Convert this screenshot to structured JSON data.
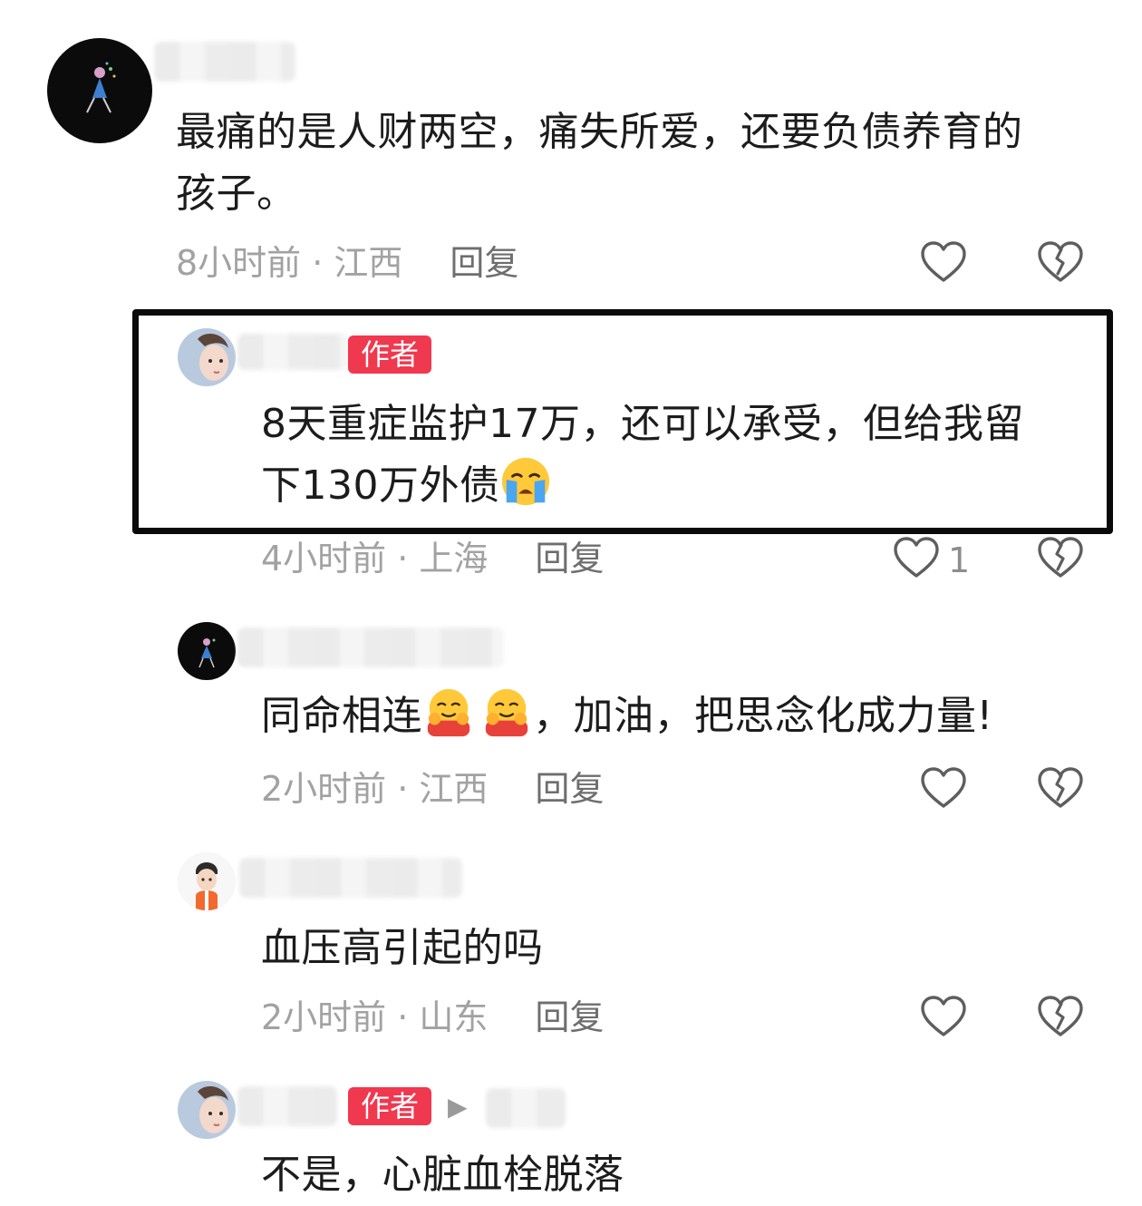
{
  "comments": [
    {
      "text_line1": "最痛的是人财两空，痛失所爱，还要负债养育的",
      "text_line2": "孩子。",
      "meta": "8小时前 · 江西",
      "reply_label": "回复"
    },
    {
      "badge": "作者",
      "text_line1": "8天重症监护17万，还可以承受，但给我留",
      "text_line2": "下130万外债",
      "meta": "4小时前 · 上海",
      "reply_label": "回复",
      "like_count": "1"
    },
    {
      "text_before_emoji": "同命相连",
      "text_after_emoji": "，加油，把思念化成力量!",
      "meta": "2小时前 · 江西",
      "reply_label": "回复"
    },
    {
      "text": "血压高引起的吗",
      "meta": "2小时前 · 山东",
      "reply_label": "回复"
    },
    {
      "badge": "作者",
      "text": "不是，心脏血栓脱落"
    }
  ],
  "icons": {
    "like": "heart-outline-icon",
    "dislike": "broken-heart-icon",
    "crying": "loudly-crying-face-emoji",
    "hug": "smiling-face-with-open-hands-emoji"
  },
  "colors": {
    "author_badge": "#f0384f",
    "meta_text": "#a2a2a2",
    "reply_text": "#6e6e6e",
    "highlight_border": "#0a0a0a"
  }
}
